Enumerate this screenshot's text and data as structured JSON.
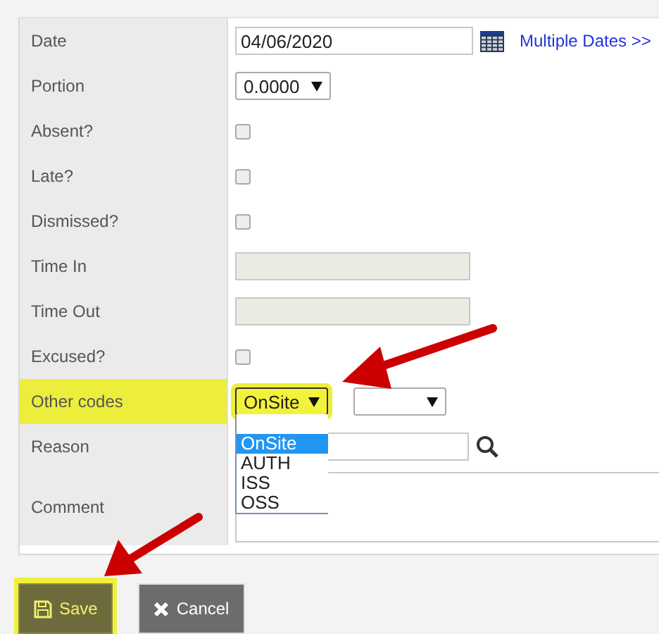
{
  "form": {
    "rows": [
      {
        "kind": "date",
        "label": "Date",
        "value": "04/06/2020",
        "link": "Multiple Dates >>"
      },
      {
        "kind": "select",
        "label": "Portion",
        "value": "0.0000"
      },
      {
        "kind": "checkbox",
        "label": "Absent?",
        "checked": false
      },
      {
        "kind": "checkbox",
        "label": "Late?",
        "checked": false
      },
      {
        "kind": "checkbox",
        "label": "Dismissed?",
        "checked": false
      },
      {
        "kind": "text",
        "label": "Time In",
        "disabled": true
      },
      {
        "kind": "text",
        "label": "Time Out",
        "disabled": true
      },
      {
        "kind": "checkbox",
        "label": "Excused?",
        "checked": false
      },
      {
        "kind": "codes",
        "label": "Other codes",
        "value": "OnSite",
        "highlighted": true,
        "expanded": true,
        "options": [
          {
            "label": "OnSite",
            "selected": true
          },
          {
            "label": "AUTH",
            "selected": false
          },
          {
            "label": "ISS",
            "selected": false
          },
          {
            "label": "OSS",
            "selected": false
          }
        ]
      },
      {
        "kind": "reason",
        "label": "Reason"
      },
      {
        "kind": "comment",
        "label": "Comment"
      }
    ]
  },
  "buttons": [
    {
      "kind": "save",
      "label": "Save",
      "highlighted": true
    },
    {
      "kind": "cancel",
      "label": "Cancel",
      "highlighted": false
    }
  ]
}
